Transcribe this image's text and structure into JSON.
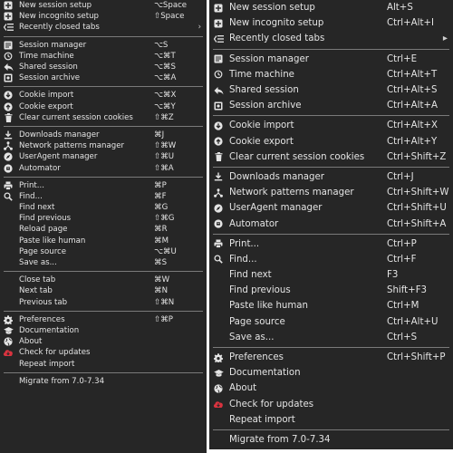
{
  "menus": {
    "mac": {
      "groups": [
        [
          {
            "label": "New session setup",
            "shortcut": "⌥Space",
            "icon": "plus-box-icon"
          },
          {
            "label": "New incognito setup",
            "shortcut": "⇧Space",
            "icon": "plus-box-icon"
          },
          {
            "label": "Recently closed tabs",
            "shortcut": "",
            "icon": "recent-list-icon",
            "submenu": "›"
          }
        ],
        [
          {
            "label": "Session manager",
            "shortcut": "⌥S",
            "icon": "session-manager-icon"
          },
          {
            "label": "Time machine",
            "shortcut": "⌥⌘T",
            "icon": "history-icon"
          },
          {
            "label": "Shared session",
            "shortcut": "⌥⌘S",
            "icon": "share-icon"
          },
          {
            "label": "Session archive",
            "shortcut": "⌥⌘A",
            "icon": "archive-icon"
          }
        ],
        [
          {
            "label": "Cookie import",
            "shortcut": "⌥⌘X",
            "icon": "import-icon"
          },
          {
            "label": "Cookie export",
            "shortcut": "⌥⌘Y",
            "icon": "export-icon"
          },
          {
            "label": "Clear current session cookies",
            "shortcut": "⇧⌘Z",
            "icon": "trash-icon"
          }
        ],
        [
          {
            "label": "Downloads manager",
            "shortcut": "⌘J",
            "icon": "download-icon"
          },
          {
            "label": "Network patterns manager",
            "shortcut": "⇧⌘W",
            "icon": "network-icon"
          },
          {
            "label": "UserAgent manager",
            "shortcut": "⇧⌘U",
            "icon": "compass-icon"
          },
          {
            "label": "Automator",
            "shortcut": "⇧⌘A",
            "icon": "robot-icon"
          }
        ],
        [
          {
            "label": "Print...",
            "shortcut": "⌘P",
            "icon": "print-icon"
          },
          {
            "label": "Find...",
            "shortcut": "⌘F",
            "icon": "search-icon"
          },
          {
            "label": "Find next",
            "shortcut": "⌘G",
            "icon": ""
          },
          {
            "label": "Find previous",
            "shortcut": "⇧⌘G",
            "icon": ""
          },
          {
            "label": "Reload page",
            "shortcut": "⌘R",
            "icon": ""
          },
          {
            "label": "Paste like human",
            "shortcut": "⌘M",
            "icon": ""
          },
          {
            "label": "Page source",
            "shortcut": "⌥⌘U",
            "icon": ""
          },
          {
            "label": "Save as...",
            "shortcut": "⌘S",
            "icon": ""
          }
        ],
        [
          {
            "label": "Close tab",
            "shortcut": "⌘W",
            "icon": ""
          },
          {
            "label": "Next tab",
            "shortcut": "⌘N",
            "icon": ""
          },
          {
            "label": "Previous tab",
            "shortcut": "⇧⌘N",
            "icon": ""
          }
        ],
        [
          {
            "label": "Preferences",
            "shortcut": "⇧⌘P",
            "icon": "gear-icon"
          },
          {
            "label": "Documentation",
            "shortcut": "",
            "icon": "graduation-cap-icon"
          },
          {
            "label": "About",
            "shortcut": "",
            "icon": "globe-icon"
          },
          {
            "label": "Check for updates",
            "shortcut": "",
            "icon": "cloud-download-icon"
          },
          {
            "label": "Repeat import",
            "shortcut": "",
            "icon": ""
          }
        ],
        [
          {
            "label": "Migrate from 7.0-7.34",
            "shortcut": "",
            "icon": ""
          }
        ]
      ]
    },
    "win": {
      "groups": [
        [
          {
            "label": "New session setup",
            "shortcut": "Alt+S",
            "icon": "plus-box-icon"
          },
          {
            "label": "New incognito setup",
            "shortcut": "Ctrl+Alt+I",
            "icon": "plus-box-icon"
          },
          {
            "label": "Recently closed tabs",
            "shortcut": "",
            "icon": "recent-list-icon",
            "submenu": "▸"
          }
        ],
        [
          {
            "label": "Session manager",
            "shortcut": "Ctrl+E",
            "icon": "session-manager-icon"
          },
          {
            "label": "Time machine",
            "shortcut": "Ctrl+Alt+T",
            "icon": "history-icon"
          },
          {
            "label": "Shared session",
            "shortcut": "Ctrl+Alt+S",
            "icon": "share-icon"
          },
          {
            "label": "Session archive",
            "shortcut": "Ctrl+Alt+A",
            "icon": "archive-icon"
          }
        ],
        [
          {
            "label": "Cookie import",
            "shortcut": "Ctrl+Alt+X",
            "icon": "import-icon"
          },
          {
            "label": "Cookie export",
            "shortcut": "Ctrl+Alt+Y",
            "icon": "export-icon"
          },
          {
            "label": "Clear current session cookies",
            "shortcut": "Ctrl+Shift+Z",
            "icon": "trash-icon"
          }
        ],
        [
          {
            "label": "Downloads manager",
            "shortcut": "Ctrl+J",
            "icon": "download-icon"
          },
          {
            "label": "Network patterns manager",
            "shortcut": "Ctrl+Shift+W",
            "icon": "network-icon"
          },
          {
            "label": "UserAgent manager",
            "shortcut": "Ctrl+Shift+U",
            "icon": "compass-icon"
          },
          {
            "label": "Automator",
            "shortcut": "Ctrl+Shift+A",
            "icon": "robot-icon"
          }
        ],
        [
          {
            "label": "Print...",
            "shortcut": "Ctrl+P",
            "icon": "print-icon"
          },
          {
            "label": "Find...",
            "shortcut": "Ctrl+F",
            "icon": "search-icon"
          },
          {
            "label": "Find next",
            "shortcut": "F3",
            "icon": ""
          },
          {
            "label": "Find previous",
            "shortcut": "Shift+F3",
            "icon": ""
          },
          {
            "label": "Paste like human",
            "shortcut": "Ctrl+M",
            "icon": ""
          },
          {
            "label": "Page source",
            "shortcut": "Ctrl+Alt+U",
            "icon": ""
          },
          {
            "label": "Save as...",
            "shortcut": "Ctrl+S",
            "icon": ""
          }
        ],
        [
          {
            "label": "Preferences",
            "shortcut": "Ctrl+Shift+P",
            "icon": "gear-icon"
          },
          {
            "label": "Documentation",
            "shortcut": "",
            "icon": "graduation-cap-icon"
          },
          {
            "label": "About",
            "shortcut": "",
            "icon": "globe-icon"
          },
          {
            "label": "Check for updates",
            "shortcut": "",
            "icon": "cloud-download-icon"
          },
          {
            "label": "Repeat import",
            "shortcut": "",
            "icon": ""
          }
        ],
        [
          {
            "label": "Migrate from 7.0-7.34",
            "shortcut": "",
            "icon": ""
          }
        ]
      ]
    }
  },
  "colors": {
    "menu_bg": "#262626",
    "text": "#e4e4e4",
    "separator": "#7a7a7a",
    "update_icon": "#d9333f"
  }
}
